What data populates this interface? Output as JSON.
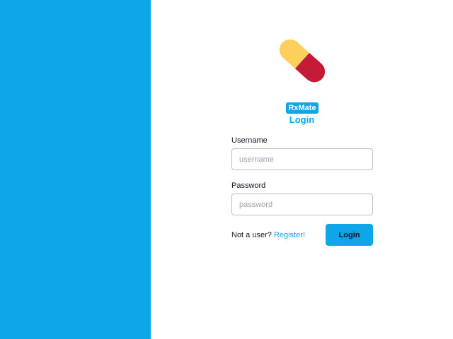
{
  "brand": {
    "name": "RxMate",
    "logo_icon": "pill-capsule-icon"
  },
  "form": {
    "title": "Login",
    "username": {
      "label": "Username",
      "placeholder": "username",
      "value": ""
    },
    "password": {
      "label": "Password",
      "placeholder": "password",
      "value": ""
    },
    "register_prompt": "Not a user?",
    "register_link": "Register!",
    "submit_label": "Login"
  },
  "colors": {
    "accent": "#0ea5e9",
    "capsule_top": "#fdd05c",
    "capsule_bottom": "#c21a37"
  }
}
